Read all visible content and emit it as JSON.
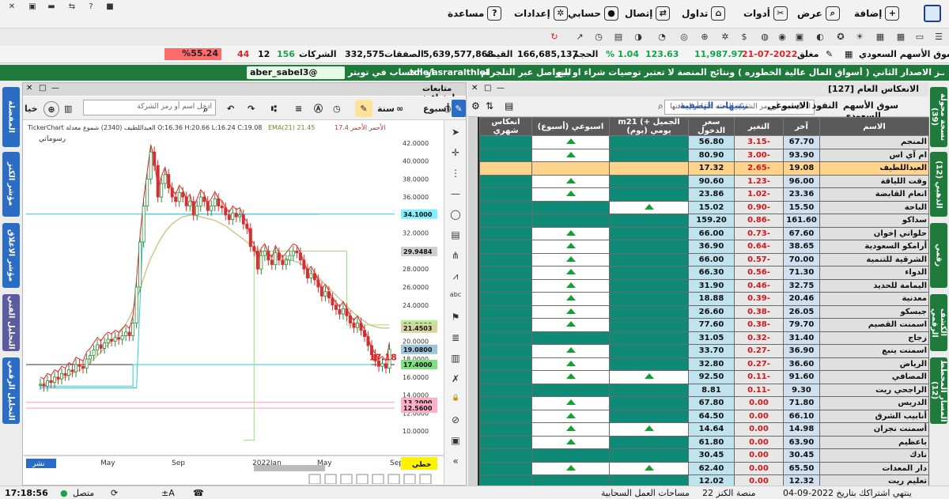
{
  "menu": {
    "items": [
      {
        "key": "add",
        "label": "إضافة",
        "icon": "add-icon",
        "x": 1080
      },
      {
        "key": "view",
        "label": "عرض",
        "icon": "view-icon",
        "x": 1008
      },
      {
        "key": "tools",
        "label": "أدوات",
        "icon": "tools-icon",
        "x": 940
      },
      {
        "key": "trade",
        "label": "تداول",
        "icon": "cart-icon",
        "x": 862
      },
      {
        "key": "connect",
        "label": "إتصال",
        "icon": "connect-icon",
        "x": 790
      },
      {
        "key": "account",
        "label": "حسابي",
        "icon": "user-icon",
        "x": 718
      },
      {
        "key": "settings",
        "label": "إعدادات",
        "icon": "gear-icon",
        "x": 650
      },
      {
        "key": "help",
        "label": "مساعدة",
        "icon": "help-icon",
        "x": 566
      }
    ]
  },
  "stats": {
    "market": "سوق الأسهم السعودي",
    "status": "مغلق",
    "date": "21-07-2022",
    "index": "11,987.97",
    "change": "123.63",
    "change_pct": "% 1.04",
    "volume_label": "الحجم",
    "volume": "166,685,137",
    "value_label": "القيمة",
    "value": "5,639,577,868",
    "deals_label": "الصفقات",
    "deals": "332,575",
    "companies_label": "الشركات",
    "up_count": "156",
    "flat_count": "12",
    "down_count": "44",
    "breadth_pct": "%55.24",
    "colors": {
      "up": "#16a34a",
      "down": "#dc2626",
      "breadth": "#ff6b6b"
    }
  },
  "ticker": {
    "news": "مـنـصـة الـكـنـز الاصدار الثاني ( أسواق المال عالية الخطوره ) ونتائج المنصة لا تعتبر توصيات شراء او بيع",
    "telegram_label": "للتواصل عبر التلجرام",
    "telegram": "tme/asraralthlel",
    "twitter_label": "او الحساب في تويتر",
    "twitter": "aber_sabel3@"
  },
  "left_tabs": [
    {
      "label": "المفضلة",
      "color": "#2b6cc4"
    },
    {
      "label": "مؤشر الكنز",
      "color": "#2b6cc4"
    },
    {
      "label": "مؤشر الاغلاق",
      "color": "#2b6cc4"
    },
    {
      "label": "التحليل الفني",
      "color": "#5b5ba0"
    },
    {
      "label": "التحليل الرقمي",
      "color": "#2b6cc4"
    }
  ],
  "right_tabs": [
    {
      "label": "نسخة محولة (39)",
      "color": "#1f7a3c"
    },
    {
      "label": "الذهبي (12)",
      "color": "#1f7a3c"
    },
    {
      "label": "رقمي",
      "color": "#1f7a3c"
    },
    {
      "label": "الكشف الرقمي",
      "color": "#1f7a3c"
    },
    {
      "label": "المسار المخطط (12)",
      "color": "#1f7a3c"
    }
  ],
  "chart_panel": {
    "title": "متابعات احترافية",
    "period": "أسبوع",
    "range": "سنة",
    "search_placeholder": "ادخل اسم أو رمز الشركة",
    "ohlc": "TickerChart العبداللطيف (2340) شموع معدلة O:16.36 H:20.66 L:16.24 C:19.08",
    "ema": "EMA(21) 21.45",
    "legend_extra": "الأحمر الأحمر 17.4",
    "draw_label": "رسوماتي",
    "share_label": "نشر",
    "indicator_label": "خطي",
    "last_price": "17.18"
  },
  "chart_data": {
    "type": "candlestick",
    "title": "",
    "x_ticks": [
      "May",
      "Sep",
      "2022Jan",
      "May",
      "Sep"
    ],
    "y_ticks": [
      10,
      12,
      14,
      16,
      18,
      20,
      22,
      24,
      26,
      28,
      30,
      32,
      34,
      36,
      38,
      40,
      42
    ],
    "ylim": [
      8,
      44
    ],
    "price_tags": [
      {
        "value": "34.1000",
        "color": "#7ff0ff"
      },
      {
        "value": "29.9484",
        "color": "#cfcfcf"
      },
      {
        "value": "21.8000",
        "color": "#b4f08c"
      },
      {
        "value": "21.4503",
        "color": "#d8d4a0"
      },
      {
        "value": "19.0800",
        "color": "#9fc3d7"
      },
      {
        "value": "17.4000",
        "color": "#7ee07e"
      },
      {
        "value": "13.2000",
        "color": "#ffb0c8"
      },
      {
        "value": "12.5600",
        "color": "#ffb0c8"
      }
    ],
    "closes": [
      15.2,
      15.0,
      15.6,
      15.4,
      16.0,
      15.8,
      16.4,
      16.2,
      16.8,
      16.6,
      17.4,
      17.2,
      17.0,
      18.0,
      18.4,
      19.0,
      19.6,
      19.2,
      19.8,
      20.2,
      20.0,
      20.4,
      20.2,
      20.6,
      21.0,
      20.6,
      22.0,
      26.0,
      31.0,
      35.0,
      38.0,
      41.0,
      39.5,
      36.0,
      37.5,
      38.5,
      37.0,
      36.0,
      35.5,
      36.5,
      36.0,
      35.0,
      35.5,
      34.0,
      35.0,
      36.0,
      35.5,
      34.5,
      35.0,
      35.8,
      35.0,
      34.8,
      34.0,
      33.5,
      34.2,
      33.8,
      34.0,
      33.0,
      32.5,
      30.5,
      30.0,
      28.0,
      29.5,
      30.0,
      29.0,
      28.5,
      29.8,
      29.0,
      28.5,
      29.0,
      29.5,
      30.0,
      29.8,
      29.0,
      28.0,
      27.0,
      27.5,
      26.8,
      26.0,
      25.0,
      25.5,
      24.8,
      24.0,
      23.5,
      23.0,
      23.6,
      22.8,
      22.0,
      21.5,
      22.0,
      21.2,
      20.5,
      19.5,
      18.5,
      17.8,
      17.2,
      17.5,
      17.0,
      19.08
    ],
    "ema": [
      15.2,
      15.3,
      15.4,
      15.5,
      15.6,
      15.7,
      15.9,
      16.0,
      16.2,
      16.4,
      16.6,
      16.8,
      17.0,
      17.3,
      17.6,
      18.0,
      18.4,
      18.8,
      19.2,
      19.6,
      20.0,
      20.4,
      20.8,
      21.3,
      21.9,
      22.6,
      23.5,
      24.6,
      25.8,
      27.0,
      28.2,
      29.2,
      30.0,
      30.8,
      31.5,
      32.1,
      32.6,
      33.0,
      33.3,
      33.6,
      33.8,
      33.9,
      34.0,
      34.0,
      33.9,
      33.8,
      33.7,
      33.6,
      33.5,
      33.4,
      33.2,
      33.0,
      32.8,
      32.5,
      32.2,
      31.9,
      31.6,
      31.3,
      31.0,
      30.7,
      30.4,
      30.2,
      30.0,
      29.8,
      29.6,
      29.5,
      29.4,
      29.3,
      29.2,
      29.1,
      29.0,
      28.9,
      28.8,
      28.6,
      28.4,
      28.1,
      27.8,
      27.5,
      27.1,
      26.7,
      26.3,
      25.9,
      25.5,
      25.1,
      24.7,
      24.3,
      23.9,
      23.5,
      23.1,
      22.8,
      22.5,
      22.2,
      21.9,
      21.7,
      21.6,
      21.5,
      21.45,
      21.45,
      21.45
    ]
  },
  "table_panel": {
    "title": "الانعكاس العام [127]",
    "market_filter": "سوق الأسهم السعودي",
    "filter_label": "النفوذ الاسبوعي",
    "alerts_label": "تنبيهات التصفية",
    "search_placeholder": "ادخل اسم أو رمز الشركة للبحث عنها أو إضافتها",
    "columns": [
      "الاسم",
      "آخر",
      "التغير",
      "سعر الدخول",
      "m21 (+ الجميل يومي (يوم)",
      "اسبوعي (أسبوع)",
      "انعكاس شهري"
    ],
    "rows": [
      {
        "name": "المنجم",
        "last": "67.70",
        "chg": "3.15-",
        "entry": "56.80",
        "d": 0,
        "w": 1
      },
      {
        "name": "ام آي اس",
        "last": "93.90",
        "chg": "3.00-",
        "entry": "80.90",
        "d": 0,
        "w": 1
      },
      {
        "name": "العبداللطيف",
        "last": "19.08",
        "chg": "2.65-",
        "entry": "17.32",
        "d": 0,
        "w": 0,
        "sel": true
      },
      {
        "name": "وقت اللياقة",
        "last": "96.00",
        "chg": "1.23-",
        "entry": "90.60",
        "d": 0,
        "w": 1
      },
      {
        "name": "انعام القابضة",
        "last": "23.36",
        "chg": "1.02-",
        "entry": "23.86",
        "d": 0,
        "w": 1
      },
      {
        "name": "الباحة",
        "last": "15.50",
        "chg": "0.90-",
        "entry": "15.02",
        "d": 1,
        "w": 0
      },
      {
        "name": "سداكو",
        "last": "161.60",
        "chg": "0.86-",
        "entry": "159.20",
        "d": 0,
        "w": 0
      },
      {
        "name": "حلواني إخوان",
        "last": "67.60",
        "chg": "0.73-",
        "entry": "66.00",
        "d": 0,
        "w": 1
      },
      {
        "name": "أرامكو السعودية",
        "last": "38.65",
        "chg": "0.64-",
        "entry": "36.90",
        "d": 0,
        "w": 1
      },
      {
        "name": "الشرقية للتنمية",
        "last": "70.00",
        "chg": "0.57-",
        "entry": "66.00",
        "d": 0,
        "w": 1
      },
      {
        "name": "الدواء",
        "last": "71.30",
        "chg": "0.56-",
        "entry": "66.30",
        "d": 0,
        "w": 1
      },
      {
        "name": "اليمامة للحديد",
        "last": "32.75",
        "chg": "0.46-",
        "entry": "31.90",
        "d": 0,
        "w": 1
      },
      {
        "name": "معدنية",
        "last": "20.46",
        "chg": "0.39-",
        "entry": "18.88",
        "d": 0,
        "w": 1
      },
      {
        "name": "جبسكو",
        "last": "26.05",
        "chg": "0.38-",
        "entry": "26.60",
        "d": 0,
        "w": 1
      },
      {
        "name": "اسمنت القصيم",
        "last": "79.70",
        "chg": "0.38-",
        "entry": "77.60",
        "d": 0,
        "w": 1
      },
      {
        "name": "زجاج",
        "last": "31.40",
        "chg": "0.32-",
        "entry": "31.05",
        "d": 0,
        "w": 0
      },
      {
        "name": "اسمنت ينبع",
        "last": "36.90",
        "chg": "0.27-",
        "entry": "33.70",
        "d": 0,
        "w": 1
      },
      {
        "name": "الرياض",
        "last": "36.60",
        "chg": "0.27-",
        "entry": "32.80",
        "d": 0,
        "w": 1
      },
      {
        "name": "المصافي",
        "last": "91.60",
        "chg": "0.11-",
        "entry": "92.50",
        "d": 1,
        "w": 1
      },
      {
        "name": "الراجحي ريت",
        "last": "9.30",
        "chg": "0.11-",
        "entry": "8.81",
        "d": 0,
        "w": 0
      },
      {
        "name": "الدريس",
        "last": "71.80",
        "chg": "0.00",
        "entry": "67.80",
        "d": 0,
        "w": 1
      },
      {
        "name": "أنابيب الشرق",
        "last": "66.10",
        "chg": "0.00",
        "entry": "64.50",
        "d": 0,
        "w": 1
      },
      {
        "name": "أسمنت نجران",
        "last": "14.98",
        "chg": "0.00",
        "entry": "14.64",
        "d": 1,
        "w": 1
      },
      {
        "name": "باعظيم",
        "last": "63.90",
        "chg": "0.00",
        "entry": "61.80",
        "d": 0,
        "w": 1
      },
      {
        "name": "نادك",
        "last": "30.45",
        "chg": "0.00",
        "entry": "30.45",
        "d": 0,
        "w": 0
      },
      {
        "name": "دار المعدات",
        "last": "65.50",
        "chg": "0.00",
        "entry": "62.40",
        "d": 1,
        "w": 1
      },
      {
        "name": "تعليم ريت",
        "last": "12.32",
        "chg": "0.00",
        "entry": "12.02",
        "d": 0,
        "w": 0
      }
    ]
  },
  "statusbar": {
    "time": "17:18:56",
    "connected": "متصل",
    "workspace": "مساحات العمل السحابية",
    "platform": "منصة الكنز 22",
    "subscription": "ينتهي اشتراكك بتاريخ 2022-09-04"
  }
}
